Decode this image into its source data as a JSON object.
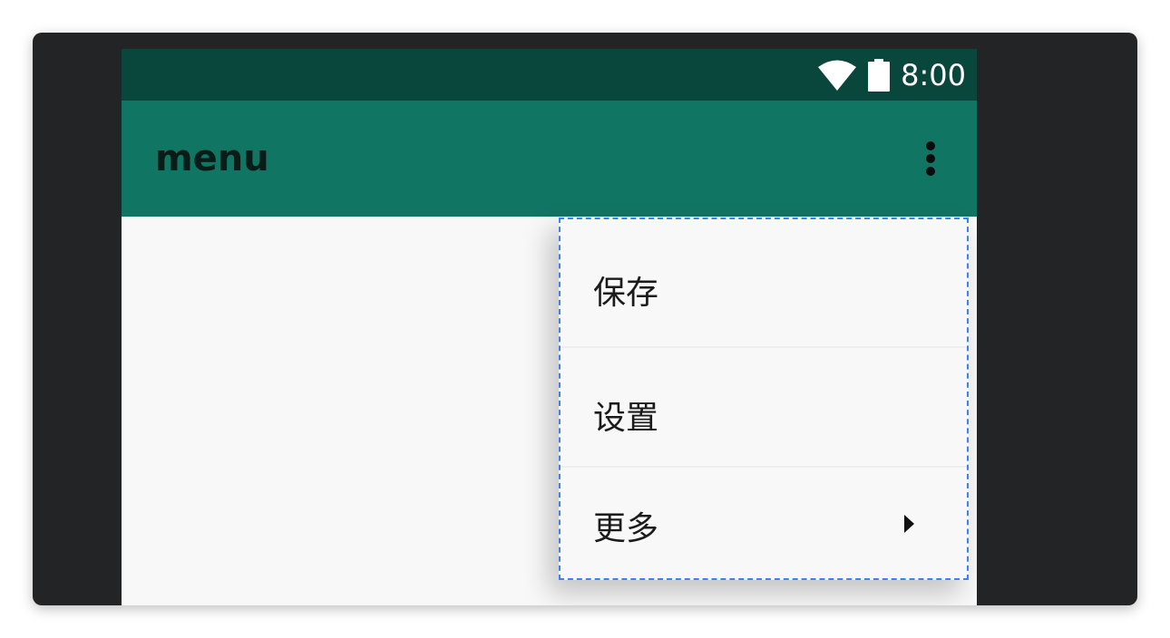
{
  "status_bar": {
    "time": "8:00",
    "icons": [
      "wifi-icon",
      "battery-icon"
    ]
  },
  "app_bar": {
    "title": "menu",
    "overflow_icon": "more-vert-icon"
  },
  "popup_menu": {
    "items": [
      {
        "label": "保存",
        "has_submenu": false
      },
      {
        "label": "设置",
        "has_submenu": false
      },
      {
        "label": "更多",
        "has_submenu": true,
        "submenu_icon": "submenu-arrow-icon"
      }
    ]
  },
  "colors": {
    "status_bar": "#09463b",
    "app_bar": "#117564",
    "background": "#f8f8f8",
    "frame": "#232425",
    "selection_outline": "#3b82f6"
  }
}
